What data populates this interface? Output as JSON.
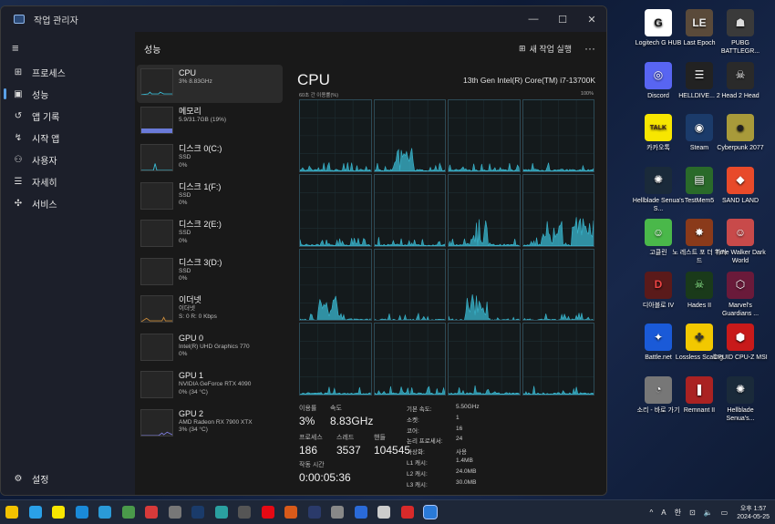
{
  "window": {
    "title": "작업 관리자",
    "min": "—",
    "max": "☐",
    "close": "✕"
  },
  "sidebar": {
    "menu_icon": "≡",
    "items": [
      {
        "label": "프로세스",
        "icon": "⊞"
      },
      {
        "label": "성능",
        "icon": "▣"
      },
      {
        "label": "앱 기록",
        "icon": "↺"
      },
      {
        "label": "시작 앱",
        "icon": "↯"
      },
      {
        "label": "사용자",
        "icon": "⚇"
      },
      {
        "label": "자세히",
        "icon": "☰"
      },
      {
        "label": "서비스",
        "icon": "✣"
      }
    ],
    "settings": {
      "label": "설정",
      "icon": "⚙"
    }
  },
  "header": {
    "title": "성능",
    "new_task": "새 작업 실행",
    "new_task_icon": "⊞",
    "more": "···"
  },
  "perf_list": [
    {
      "name": "CPU",
      "l1": "3%  8.83GHz",
      "l2": "",
      "thumb": "cpu"
    },
    {
      "name": "메모리",
      "l1": "5.9/31.7GB (19%)",
      "l2": "",
      "thumb": "mem"
    },
    {
      "name": "디스크 0(C:)",
      "l1": "SSD",
      "l2": "0%",
      "thumb": "disk"
    },
    {
      "name": "디스크 1(F:)",
      "l1": "SSD",
      "l2": "0%",
      "thumb": "none"
    },
    {
      "name": "디스크 2(E:)",
      "l1": "SSD",
      "l2": "0%",
      "thumb": "none"
    },
    {
      "name": "디스크 3(D:)",
      "l1": "SSD",
      "l2": "0%",
      "thumb": "none"
    },
    {
      "name": "이더넷",
      "l1": "이더넷",
      "l2": "S: 0  R: 0 Kbps",
      "thumb": "net"
    },
    {
      "name": "GPU 0",
      "l1": "Intel(R) UHD Graphics 770",
      "l2": "0%",
      "thumb": "none"
    },
    {
      "name": "GPU 1",
      "l1": "NVIDIA GeForce RTX 4090",
      "l2": "0% (34 °C)",
      "thumb": "none"
    },
    {
      "name": "GPU 2",
      "l1": "AMD Radeon RX 7900 XTX",
      "l2": "3% (34 °C)",
      "thumb": "gpu"
    }
  ],
  "cpu": {
    "title": "CPU",
    "model": "13th Gen Intel(R) Core(TM) i7-13700K",
    "util_label": "60초 간 이용률(%)",
    "util_max": "100%",
    "stats": {
      "util_label": "이용률",
      "util_value": "3%",
      "speed_label": "속도",
      "speed_value": "8.83GHz",
      "proc_label": "프로세스",
      "proc_value": "186",
      "thread_label": "스레드",
      "thread_value": "3537",
      "handle_label": "핸들",
      "handle_value": "104545",
      "uptime_label": "작동 시간",
      "uptime_value": "0:00:05:36"
    },
    "specs": [
      {
        "k": "기본 속도:",
        "v": "5.50GHz"
      },
      {
        "k": "소켓:",
        "v": "1"
      },
      {
        "k": "코어:",
        "v": "16"
      },
      {
        "k": "논리 프로세서:",
        "v": "24"
      },
      {
        "k": "가상화:",
        "v": "사용"
      },
      {
        "k": "L1 캐시:",
        "v": "1.4MB"
      },
      {
        "k": "L2 캐시:",
        "v": "24.0MB"
      },
      {
        "k": "L3 캐시:",
        "v": "30.0MB"
      }
    ],
    "graph_color": "#3ab8d0"
  },
  "desktop_icons": [
    {
      "label": "Logitech G HUB",
      "color": "#ffffff",
      "glyph": "G",
      "fg": "#111"
    },
    {
      "label": "Last Epoch",
      "color": "#5a4a3a",
      "glyph": "LE",
      "fg": "#eee"
    },
    {
      "label": "PUBG BATTLEGR...",
      "color": "#3a3a3a",
      "glyph": "☗",
      "fg": "#ddd"
    },
    {
      "label": "Discord",
      "color": "#5865f2",
      "glyph": "◎",
      "fg": "#fff"
    },
    {
      "label": "HELLDIVE... 2",
      "color": "#222222",
      "glyph": "☰",
      "fg": "#fff"
    },
    {
      "label": "Head 2 Head",
      "color": "#2a2a2a",
      "glyph": "☠",
      "fg": "#fff"
    },
    {
      "label": "카카오톡",
      "color": "#f7e600",
      "glyph": "TALK",
      "fg": "#3a1d1d"
    },
    {
      "label": "Steam",
      "color": "#1b3b6a",
      "glyph": "◉",
      "fg": "#fff"
    },
    {
      "label": "Cyberpunk 2077",
      "color": "#a89a3a",
      "glyph": "☻",
      "fg": "#222"
    },
    {
      "label": "Hellblade Senua's S...",
      "color": "#1a2a3a",
      "glyph": "✺",
      "fg": "#fff"
    },
    {
      "label": "TestMem5",
      "color": "#2a6a2a",
      "glyph": "▤",
      "fg": "#fff"
    },
    {
      "label": "SAND LAND",
      "color": "#e84a2a",
      "glyph": "◆",
      "fg": "#fff"
    },
    {
      "label": "고클린",
      "color": "#4ab84a",
      "glyph": "☺",
      "fg": "#fff"
    },
    {
      "label": "노 레스트 포 더 위키드",
      "color": "#8a3a1a",
      "glyph": "✸",
      "fg": "#fff"
    },
    {
      "label": "Time Walker Dark World",
      "color": "#c84a4a",
      "glyph": "☺",
      "fg": "#fff"
    },
    {
      "label": "디아블로 IV",
      "color": "#5a1a1a",
      "glyph": "D",
      "fg": "#e44"
    },
    {
      "label": "Hades II",
      "color": "#1a3a1a",
      "glyph": "☠",
      "fg": "#9f9"
    },
    {
      "label": "Marvel's Guardians ...",
      "color": "#6a1a3a",
      "glyph": "⬡",
      "fg": "#fff"
    },
    {
      "label": "Battle.net",
      "color": "#1a5ad8",
      "glyph": "✦",
      "fg": "#fff"
    },
    {
      "label": "Lossless Scaling",
      "color": "#f2c800",
      "glyph": "✤",
      "fg": "#333"
    },
    {
      "label": "CPUID CPU-Z MSI",
      "color": "#c81a1a",
      "glyph": "⬢",
      "fg": "#fff"
    },
    {
      "label": "소리 - 바로 가기",
      "color": "#777777",
      "glyph": "◔",
      "fg": "#fff"
    },
    {
      "label": "Remnant II",
      "color": "#aa2222",
      "glyph": "❚",
      "fg": "#fff"
    },
    {
      "label": "Hellblade Senua's...",
      "color": "#1a2a3a",
      "glyph": "✺",
      "fg": "#fff"
    }
  ],
  "taskbar": {
    "apps": [
      "#f2c200",
      "#2aa0e8",
      "#f7e600",
      "#1a8ad8",
      "#2a9ad8",
      "#4a9a4a",
      "#d83a3a",
      "#777777",
      "#1a3b6a",
      "#2aa0a0",
      "#555555",
      "#e50914",
      "#d85a1a",
      "#2a3a6a",
      "#888888",
      "#2a6ad8",
      "#cccccc",
      "#d82a2a",
      "#2a7ad8"
    ],
    "tray": {
      "chevron": "^",
      "ime1": "A",
      "ime2": "한",
      "wifi": "⊡",
      "vol": "🔈",
      "bat": "▭"
    },
    "time": "오후 1:57",
    "date": "2024-05-25"
  }
}
